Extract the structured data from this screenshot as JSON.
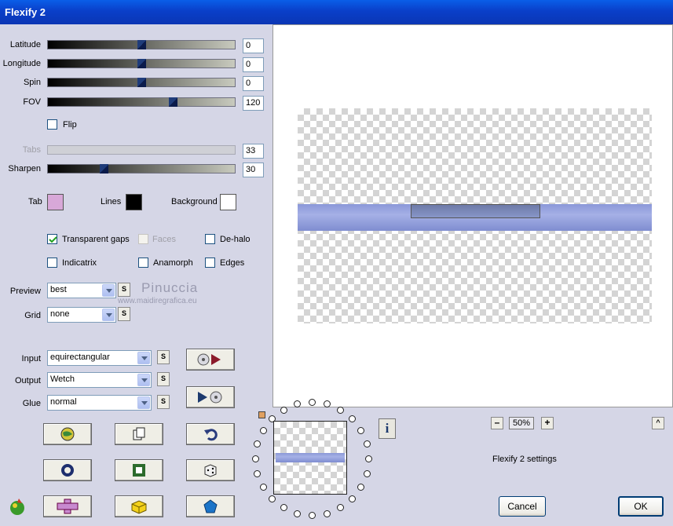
{
  "window": {
    "title": "Flexify 2"
  },
  "sliders": [
    {
      "label": "Latitude",
      "value": "0",
      "fraction": 0.5,
      "disabled": false
    },
    {
      "label": "Longitude",
      "value": "0",
      "fraction": 0.5,
      "disabled": false
    },
    {
      "label": "Spin",
      "value": "0",
      "fraction": 0.5,
      "disabled": false
    },
    {
      "label": "FOV",
      "value": "120",
      "fraction": 0.67,
      "disabled": false
    },
    {
      "label": "Tabs",
      "value": "33",
      "fraction": 0.33,
      "disabled": true
    },
    {
      "label": "Sharpen",
      "value": "30",
      "fraction": 0.3,
      "disabled": false
    }
  ],
  "flip": {
    "label": "Flip",
    "checked": false
  },
  "colors": {
    "tab": {
      "label": "Tab",
      "hex": "#d8a8d8"
    },
    "lines": {
      "label": "Lines",
      "hex": "#000000"
    },
    "background": {
      "label": "Background",
      "hex": "#ffffff"
    }
  },
  "options": {
    "transparent_gaps": {
      "label": "Transparent gaps",
      "checked": true
    },
    "faces": {
      "label": "Faces",
      "checked": false,
      "disabled": true
    },
    "de_halo": {
      "label": "De-halo",
      "checked": false
    },
    "indicatrix": {
      "label": "Indicatrix",
      "checked": false
    },
    "anamorph": {
      "label": "Anamorph",
      "checked": false
    },
    "edges": {
      "label": "Edges",
      "checked": false
    }
  },
  "preview_select": {
    "label": "Preview",
    "value": "best"
  },
  "grid_select": {
    "label": "Grid",
    "value": "none"
  },
  "input_select": {
    "label": "Input",
    "value": "equirectangular"
  },
  "output_select": {
    "label": "Output",
    "value": "Wetch"
  },
  "glue_select": {
    "label": "Glue",
    "value": "normal"
  },
  "s_label": "S",
  "watermark": {
    "name": "Pinuccia",
    "url": "www.maidiregrafica.eu"
  },
  "zoom": {
    "value": "50%",
    "minus": "–",
    "plus": "+"
  },
  "status_text": "Flexify 2 settings",
  "buttons": {
    "cancel": "Cancel",
    "ok": "OK",
    "collapse": "^"
  },
  "info_label": "i"
}
